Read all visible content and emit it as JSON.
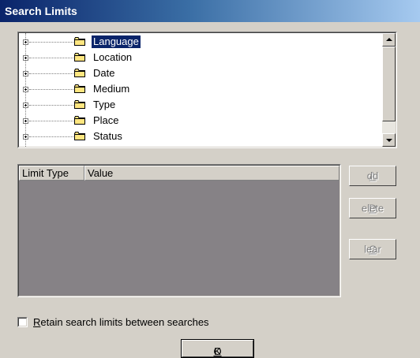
{
  "window": {
    "title": "Search Limits"
  },
  "tree": {
    "items": [
      {
        "label": "Language",
        "selected": true
      },
      {
        "label": "Location",
        "selected": false
      },
      {
        "label": "Date",
        "selected": false
      },
      {
        "label": "Medium",
        "selected": false
      },
      {
        "label": "Type",
        "selected": false
      },
      {
        "label": "Place",
        "selected": false
      },
      {
        "label": "Status",
        "selected": false
      }
    ],
    "icon": "folder-icon"
  },
  "limits_list": {
    "columns": [
      "Limit Type",
      "Value"
    ]
  },
  "buttons": {
    "add": {
      "mnemonic": "A",
      "rest": "dd",
      "enabled": false
    },
    "delete": {
      "mnemonic": "D",
      "rest": "elete",
      "enabled": false
    },
    "clear": {
      "mnemonic": "C",
      "rest": "lear",
      "enabled": false
    },
    "ok": {
      "mnemonic": "O",
      "rest": "K",
      "enabled": true
    }
  },
  "retain": {
    "mnemonic": "R",
    "rest": "etain search limits between searches",
    "checked": false
  },
  "colors": {
    "title_start": "#0a246a",
    "title_end": "#a6caf0",
    "face": "#d4d0c8",
    "list_background": "#868286",
    "selection": "#0a246a"
  }
}
